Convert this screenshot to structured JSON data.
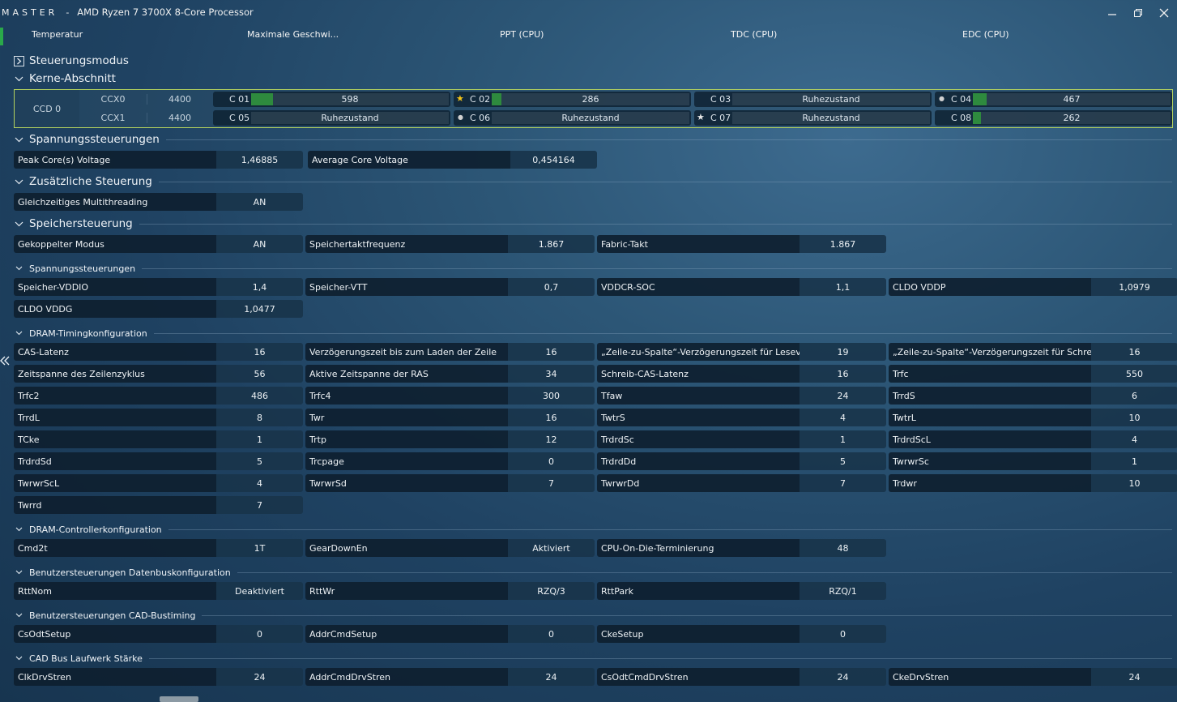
{
  "window": {
    "app": "MASTER",
    "separator": "-",
    "processor": "AMD Ryzen 7 3700X 8-Core Processor"
  },
  "column_headers": [
    "Temperatur",
    "Maximale Geschwi...",
    "PPT (CPU)",
    "TDC (CPU)",
    "EDC (CPU)"
  ],
  "sections": {
    "s1": "Steuerungsmodus",
    "s2": "Kerne-Abschnitt",
    "s3": "Spannungssteuerungen",
    "s4": "Zusätzliche Steuerung",
    "s5": "Speichersteuerung",
    "s6": "Spannungssteuerungen",
    "s7": "DRAM-Timingkonfiguration",
    "s8": "DRAM-Controllerkonfiguration",
    "s9": "Benutzersteuerungen Datenbuskonfiguration",
    "s10": "Benutzersteuerungen CAD-Bustiming",
    "s11": "CAD Bus Laufwerk Stärke"
  },
  "cores": {
    "ccd": "CCD 0",
    "ccx0": {
      "name": "CCX0",
      "freq": "4400"
    },
    "ccx1": {
      "name": "CCX1",
      "freq": "4400"
    },
    "list": [
      {
        "name": "C 01",
        "value": "598",
        "marker": "",
        "fill": 0.11
      },
      {
        "name": "C 02",
        "value": "286",
        "marker": "star-gold",
        "fill": 0.05
      },
      {
        "name": "C 03",
        "value": "Ruhezustand",
        "marker": "",
        "fill": 0
      },
      {
        "name": "C 04",
        "value": "467",
        "marker": "dot",
        "fill": 0.07
      },
      {
        "name": "C 05",
        "value": "Ruhezustand",
        "marker": "",
        "fill": 0
      },
      {
        "name": "C 06",
        "value": "Ruhezustand",
        "marker": "dot",
        "fill": 0
      },
      {
        "name": "C 07",
        "value": "Ruhezustand",
        "marker": "star-white",
        "fill": 0
      },
      {
        "name": "C 08",
        "value": "262",
        "marker": "",
        "fill": 0.04
      }
    ]
  },
  "voltage": {
    "peak_label": "Peak Core(s) Voltage",
    "peak_value": "1,46885",
    "avg_label": "Average Core Voltage",
    "avg_value": "0,454164"
  },
  "extra": {
    "smt_label": "Gleichzeitiges Multithreading",
    "smt_value": "AN"
  },
  "memory": {
    "coupled_label": "Gekoppelter Modus",
    "coupled_value": "AN",
    "memclk_label": "Speichertaktfrequenz",
    "memclk_value": "1.867",
    "fabric_label": "Fabric-Takt",
    "fabric_value": "1.867"
  },
  "memvolt": [
    {
      "label": "Speicher-VDDIO",
      "value": "1,4"
    },
    {
      "label": "Speicher-VTT",
      "value": "0,7"
    },
    {
      "label": "VDDCR-SOC",
      "value": "1,1"
    },
    {
      "label": "CLDO VDDP",
      "value": "1,0979"
    },
    {
      "label": "CLDO VDDG",
      "value": "1,0477"
    }
  ],
  "timings": [
    {
      "label": "CAS-Latenz",
      "value": "16"
    },
    {
      "label": "Verzögerungszeit bis zum Laden der Zeile",
      "value": "16"
    },
    {
      "label": "„Zeile-zu-Spalte“-Verzögerungszeit für Lesevorg...",
      "value": "19"
    },
    {
      "label": "„Zeile-zu-Spalte“-Verzögerungszeit für Schreibv...",
      "value": "16"
    },
    {
      "label": "Zeitspanne des Zeilenzyklus",
      "value": "56"
    },
    {
      "label": "Aktive Zeitspanne der RAS",
      "value": "34"
    },
    {
      "label": "Schreib-CAS-Latenz",
      "value": "16"
    },
    {
      "label": "Trfc",
      "value": "550"
    },
    {
      "label": "Trfc2",
      "value": "486"
    },
    {
      "label": "Trfc4",
      "value": "300"
    },
    {
      "label": "Tfaw",
      "value": "24"
    },
    {
      "label": "TrrdS",
      "value": "6"
    },
    {
      "label": "TrrdL",
      "value": "8"
    },
    {
      "label": "Twr",
      "value": "16"
    },
    {
      "label": "TwtrS",
      "value": "4"
    },
    {
      "label": "TwtrL",
      "value": "10"
    },
    {
      "label": "TCke",
      "value": "1"
    },
    {
      "label": "Trtp",
      "value": "12"
    },
    {
      "label": "TrdrdSc",
      "value": "1"
    },
    {
      "label": "TrdrdScL",
      "value": "4"
    },
    {
      "label": "TrdrdSd",
      "value": "5"
    },
    {
      "label": "Trcpage",
      "value": "0"
    },
    {
      "label": "TrdrdDd",
      "value": "5"
    },
    {
      "label": "TwrwrSc",
      "value": "1"
    },
    {
      "label": "TwrwrScL",
      "value": "4"
    },
    {
      "label": "TwrwrSd",
      "value": "7"
    },
    {
      "label": "TwrwrDd",
      "value": "7"
    },
    {
      "label": "Trdwr",
      "value": "10"
    },
    {
      "label": "Twrrd",
      "value": "7"
    }
  ],
  "controller": [
    {
      "label": "Cmd2t",
      "value": "1T"
    },
    {
      "label": "GearDownEn",
      "value": "Aktiviert"
    },
    {
      "label": "CPU-On-Die-Terminierung",
      "value": "48"
    }
  ],
  "databus": [
    {
      "label": "RttNom",
      "value": "Deaktiviert"
    },
    {
      "label": "RttWr",
      "value": "RZQ/3"
    },
    {
      "label": "RttPark",
      "value": "RZQ/1"
    }
  ],
  "cadtiming": [
    {
      "label": "CsOdtSetup",
      "value": "0"
    },
    {
      "label": "AddrCmdSetup",
      "value": "0"
    },
    {
      "label": "CkeSetup",
      "value": "0"
    }
  ],
  "cadstrength": [
    {
      "label": "ClkDrvStren",
      "value": "24"
    },
    {
      "label": "AddrCmdDrvStren",
      "value": "24"
    },
    {
      "label": "CsOdtCmdDrvStren",
      "value": "24"
    },
    {
      "label": "CkeDrvStren",
      "value": "24"
    }
  ],
  "icons": {
    "minimize": "minimize-icon",
    "maximize": "restore-icon",
    "close": "close-icon",
    "collapse": "double-chevron-left-icon"
  },
  "colors": {
    "accent_green": "#2e8a3e",
    "core_border": "#b5d35e",
    "star_gold": "#f5c518"
  }
}
